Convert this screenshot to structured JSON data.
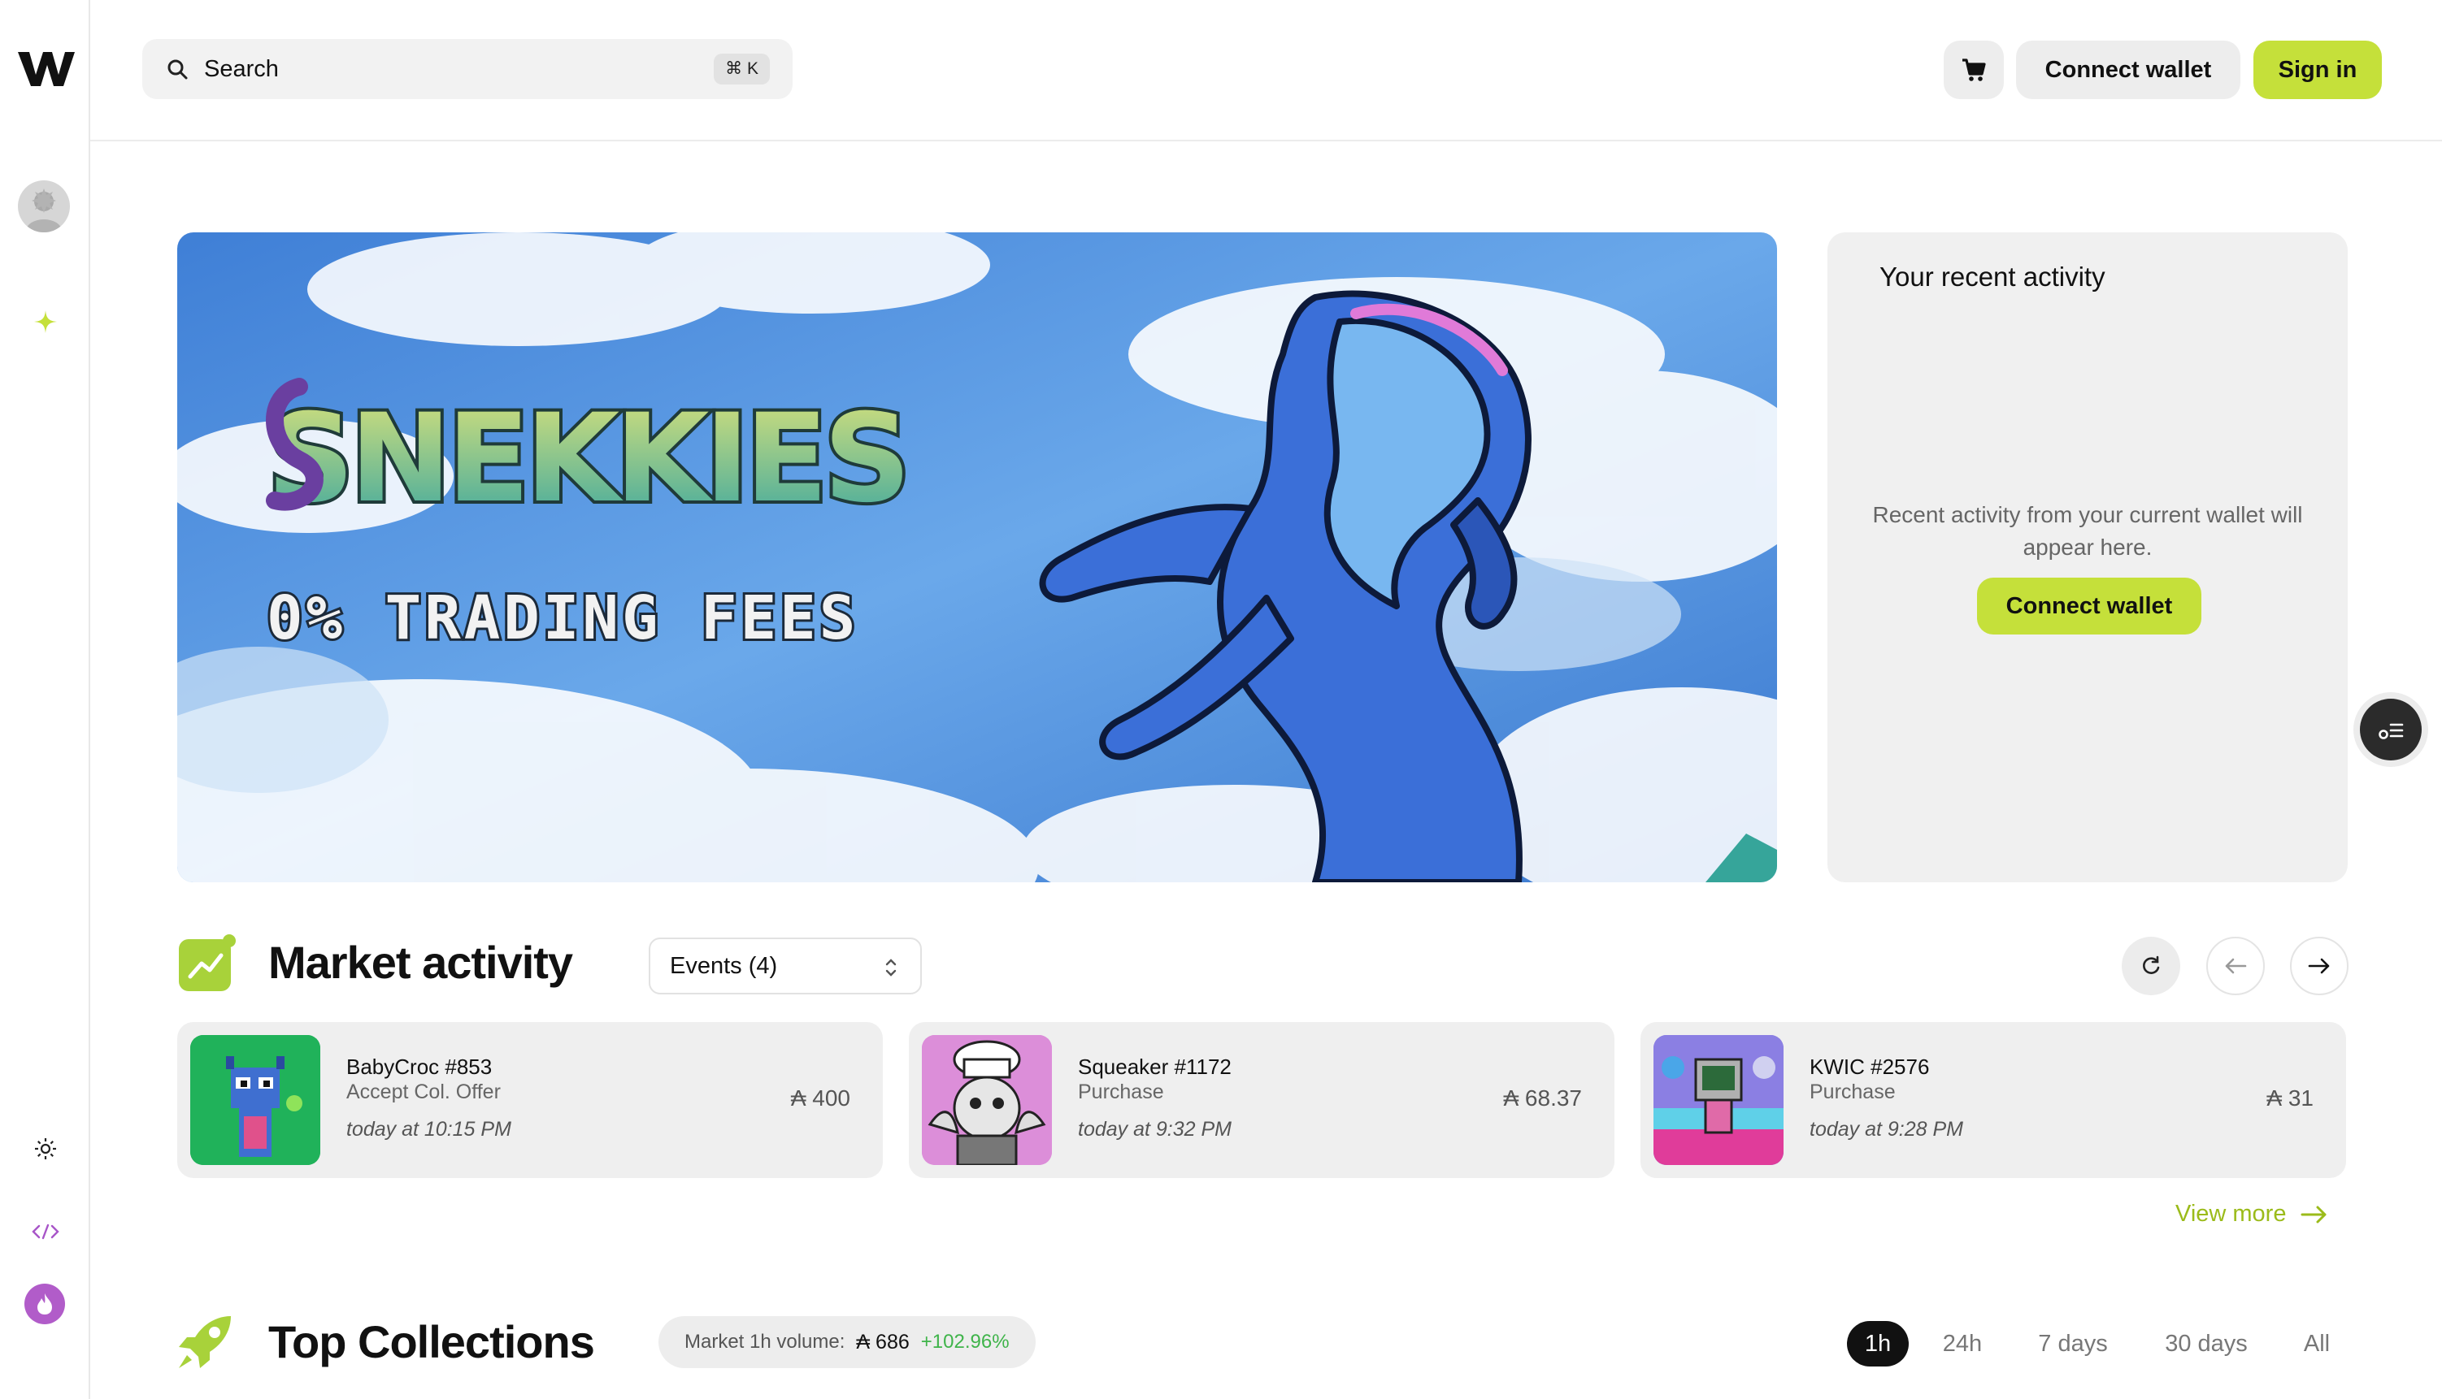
{
  "header": {
    "search_placeholder": "Search",
    "shortcut": "⌘ K",
    "connect_wallet": "Connect wallet",
    "sign_in": "Sign in"
  },
  "recent": {
    "title": "Your recent activity",
    "message": "Recent activity from your current wallet will appear here.",
    "button": "Connect wallet"
  },
  "banner": {
    "logo_text": "SNEKKIES",
    "tagline": "0% TRADING FEES"
  },
  "market": {
    "title": "Market activity",
    "filter": "Events (4)",
    "cards": [
      {
        "name": "BabyCroc #853",
        "type": "Accept Col. Offer",
        "time": "today at 10:15 PM",
        "price": "₳ 400"
      },
      {
        "name": "Squeaker #1172",
        "type": "Purchase",
        "time": "today at 9:32 PM",
        "price": "₳ 68.37"
      },
      {
        "name": "KWIC #2576",
        "type": "Purchase",
        "time": "today at 9:28 PM",
        "price": "₳ 31"
      }
    ],
    "view_more": "View more"
  },
  "collections": {
    "title": "Top Collections",
    "volume_label": "Market 1h volume:",
    "volume_value": "₳ 686",
    "volume_change": "+102.96%",
    "tabs": [
      "1h",
      "24h",
      "7 days",
      "30 days",
      "All"
    ],
    "active_tab": "1h"
  },
  "colors": {
    "accent": "#c5e03a",
    "positive": "#3fb44a",
    "dev_icon": "#a855c8"
  }
}
